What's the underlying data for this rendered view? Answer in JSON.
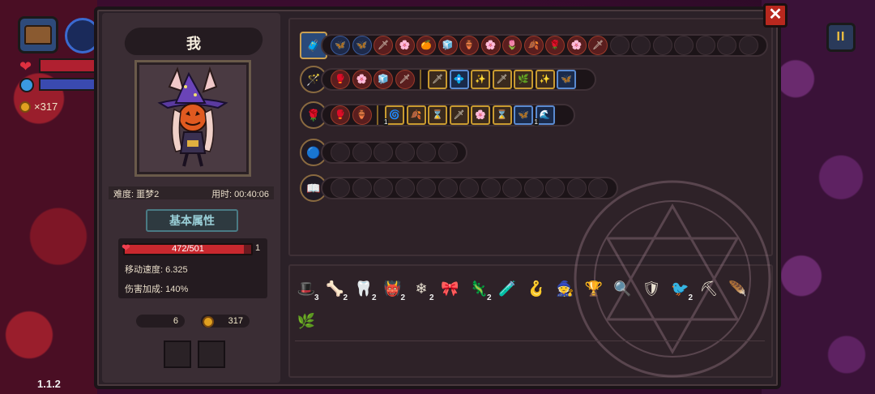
{
  "hud": {
    "coin_count": "×317",
    "version": "1.1.2",
    "pause_label": "II"
  },
  "panel": {
    "close_label": "✕",
    "player_name": "我",
    "difficulty": "难度: 噩梦2",
    "time_used": "用时: 00:40:06",
    "attributes_title": "基本属性",
    "hp_text": "472/501",
    "hp_fraction": 0.942,
    "hp_extra": "1",
    "move_speed": "移动速度: 6.325",
    "damage_bonus": "伤害加成: 140%",
    "keys": "6",
    "coins": "317"
  },
  "rows": [
    {
      "lead": "chest-icon",
      "items": [
        "🦋",
        "🦋",
        "🗡",
        "🌸",
        "🍊",
        "🧊",
        "🏺",
        "🌸",
        "🌷",
        "🍂",
        "🌹",
        "🌸",
        "🗡"
      ],
      "empty": 7
    },
    {
      "lead": "staff-icon",
      "items": [
        "🥊",
        "🌸",
        "🧊",
        "🗡"
      ],
      "upgrades": [
        "🗡",
        "💠",
        "✨",
        "🗡",
        "🌿",
        "✨",
        "🦋"
      ]
    },
    {
      "lead": "rose-icon",
      "items": [
        "🥊",
        "🏺"
      ],
      "upgrades": [
        "🌀",
        "🍂",
        "⌛",
        "🗡",
        "🌸",
        "⌛",
        "🦋",
        "🌊"
      ],
      "upgrade_badges": [
        "1",
        "1"
      ]
    },
    {
      "lead": "orb-icon",
      "items": [],
      "empty": 6
    },
    {
      "lead": "spellbook-icon",
      "items": [],
      "empty": 13
    }
  ],
  "inventory": [
    {
      "icon": "🎩",
      "count": "3"
    },
    {
      "icon": "🦴",
      "count": "2"
    },
    {
      "icon": "🦷",
      "count": "2"
    },
    {
      "icon": "👹",
      "count": "2"
    },
    {
      "icon": "❄",
      "count": "2"
    },
    {
      "icon": "🎀",
      "count": ""
    },
    {
      "icon": "🦎",
      "count": "2"
    },
    {
      "icon": "🧪",
      "count": ""
    },
    {
      "icon": "🪝",
      "count": ""
    },
    {
      "icon": "🧙",
      "count": ""
    },
    {
      "icon": "🏆",
      "count": ""
    },
    {
      "icon": "🔍",
      "count": ""
    },
    {
      "icon": "🛡",
      "count": ""
    },
    {
      "icon": "🐦",
      "count": "2"
    },
    {
      "icon": "⛏",
      "count": ""
    },
    {
      "icon": "🪶",
      "count": ""
    },
    {
      "icon": "🌿",
      "count": ""
    }
  ]
}
